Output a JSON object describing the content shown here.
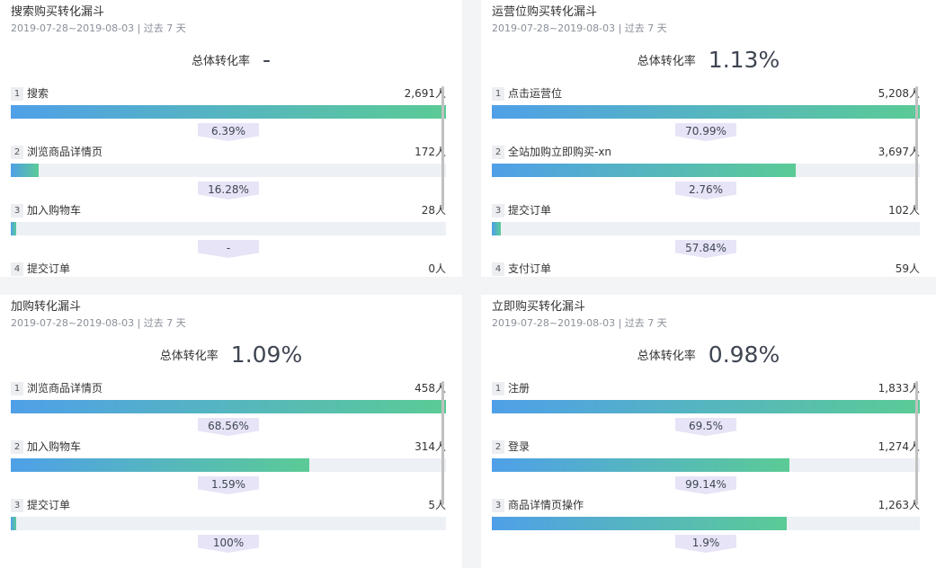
{
  "units": {
    "person": "人"
  },
  "colors": {
    "bar_start": "#4fa0e8",
    "bar_end": "#5bcb96",
    "track": "#edf0f5",
    "conversion_bg": "#e6e4f6"
  },
  "funnels": [
    {
      "title": "搜索购买转化漏斗",
      "date_range": "2019-07-28~2019-08-03 | 过去 7 天",
      "overall_label": "总体转化率",
      "overall_value": "-",
      "steps": [
        {
          "num": "1",
          "name": "搜索",
          "count": "2,691人",
          "fill_ratio": 1.0,
          "conversion": "6.39%"
        },
        {
          "num": "2",
          "name": "浏览商品详情页",
          "count": "172人",
          "fill_ratio": 0.064,
          "conversion": "16.28%"
        },
        {
          "num": "3",
          "name": "加入购物车",
          "count": "28人",
          "fill_ratio": 0.01,
          "conversion": "-"
        },
        {
          "num": "4",
          "name": "提交订单",
          "count": "0人",
          "fill_ratio": 0.0,
          "conversion": ""
        }
      ]
    },
    {
      "title": "运营位购买转化漏斗",
      "date_range": "2019-07-28~2019-08-03 | 过去 7 天",
      "overall_label": "总体转化率",
      "overall_value": "1.13%",
      "steps": [
        {
          "num": "1",
          "name": "点击运营位",
          "count": "5,208人",
          "fill_ratio": 1.0,
          "conversion": "70.99%"
        },
        {
          "num": "2",
          "name": "全站加购立即购买-xn",
          "count": "3,697人",
          "fill_ratio": 0.71,
          "conversion": "2.76%"
        },
        {
          "num": "3",
          "name": "提交订单",
          "count": "102人",
          "fill_ratio": 0.02,
          "conversion": "57.84%"
        },
        {
          "num": "4",
          "name": "支付订单",
          "count": "59人",
          "fill_ratio": 0.011,
          "conversion": ""
        }
      ]
    },
    {
      "title": "加购转化漏斗",
      "date_range": "2019-07-28~2019-08-03 | 过去 7 天",
      "overall_label": "总体转化率",
      "overall_value": "1.09%",
      "steps": [
        {
          "num": "1",
          "name": "浏览商品详情页",
          "count": "458人",
          "fill_ratio": 1.0,
          "conversion": "68.56%"
        },
        {
          "num": "2",
          "name": "加入购物车",
          "count": "314人",
          "fill_ratio": 0.686,
          "conversion": "1.59%"
        },
        {
          "num": "3",
          "name": "提交订单",
          "count": "5人",
          "fill_ratio": 0.011,
          "conversion": "100%"
        }
      ]
    },
    {
      "title": "立即购买转化漏斗",
      "date_range": "2019-07-28~2019-08-03 | 过去 7 天",
      "overall_label": "总体转化率",
      "overall_value": "0.98%",
      "steps": [
        {
          "num": "1",
          "name": "注册",
          "count": "1,833人",
          "fill_ratio": 1.0,
          "conversion": "69.5%"
        },
        {
          "num": "2",
          "name": "登录",
          "count": "1,274人",
          "fill_ratio": 0.695,
          "conversion": "99.14%"
        },
        {
          "num": "3",
          "name": "商品详情页操作",
          "count": "1,263人",
          "fill_ratio": 0.689,
          "conversion": "1.9%"
        }
      ]
    }
  ]
}
